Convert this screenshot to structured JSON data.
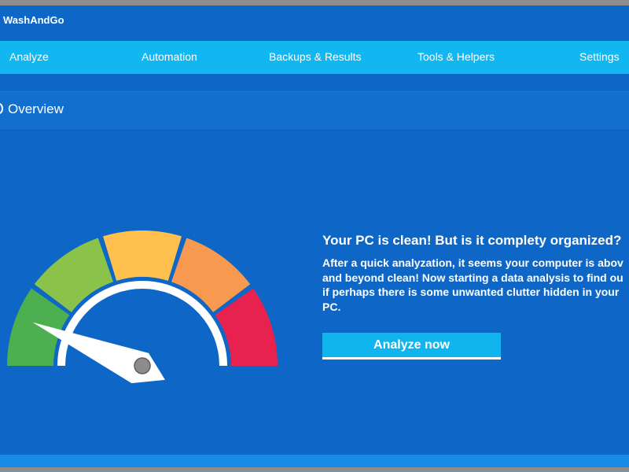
{
  "app": {
    "title": "WashAndGo"
  },
  "nav": {
    "items": [
      {
        "label": "Analyze"
      },
      {
        "label": "Automation"
      },
      {
        "label": "Backups & Results"
      },
      {
        "label": "Tools & Helpers"
      },
      {
        "label": "Settings"
      }
    ]
  },
  "section": {
    "title": "Overview"
  },
  "message": {
    "title": "Your PC is clean! But is it complety organized?",
    "lines": [
      "After a quick analyzation, it seems your computer is abov",
      "and beyond clean! Now starting a data analysis to find ou",
      "if perhaps there is some unwanted clutter hidden in your",
      "PC."
    ]
  },
  "action": {
    "label": "Analyze now"
  },
  "gauge": {
    "level_fraction": 0.12,
    "segment_colors": [
      "#4CAF50",
      "#8BC34A",
      "#FFC04D",
      "#F79A50",
      "#E8224E"
    ]
  },
  "colors": {
    "background": "#0E67C6",
    "nav_bar": "#12B7F2",
    "button": "#10B5EE"
  }
}
